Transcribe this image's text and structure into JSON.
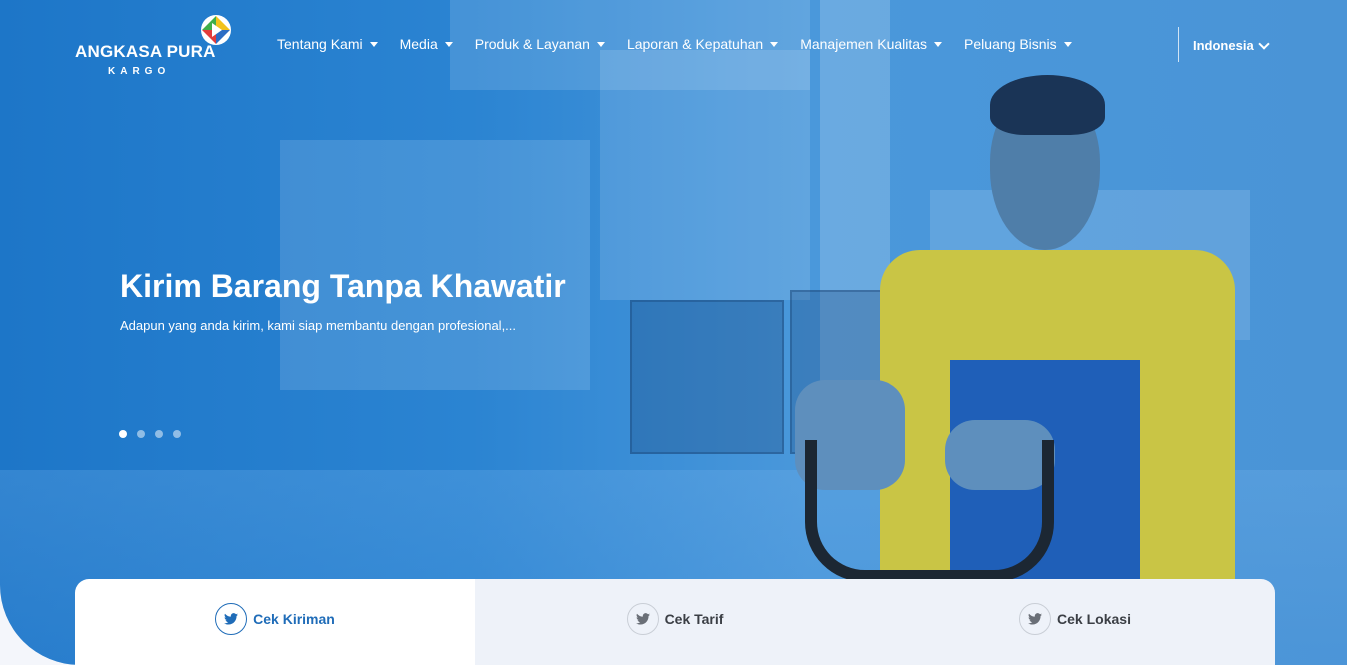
{
  "logo": {
    "title": "ANGKASA PURA",
    "subtitle": "KARGO"
  },
  "nav": {
    "items": [
      {
        "label": "Tentang Kami"
      },
      {
        "label": "Media"
      },
      {
        "label": "Produk & Layanan"
      },
      {
        "label": "Laporan & Kepatuhan"
      },
      {
        "label": "Manajemen Kualitas"
      },
      {
        "label": "Peluang Bisnis"
      }
    ],
    "language": "Indonesia"
  },
  "hero": {
    "headline": "Kirim Barang Tanpa Khawatir",
    "subline": "Adapun yang anda kirim, kami siap membantu dengan profesional,...",
    "slide_count": 4,
    "active_slide": 1
  },
  "tabs": [
    {
      "label": "Cek Kiriman",
      "icon": "twitter-icon",
      "active": true
    },
    {
      "label": "Cek Tarif",
      "icon": "twitter-icon",
      "active": false
    },
    {
      "label": "Cek Lokasi",
      "icon": "twitter-icon",
      "active": false
    }
  ],
  "colors": {
    "brand_blue": "#1f6cb8",
    "hero_blue": "#2b84d2",
    "tab_inactive": "#eef2f9"
  }
}
